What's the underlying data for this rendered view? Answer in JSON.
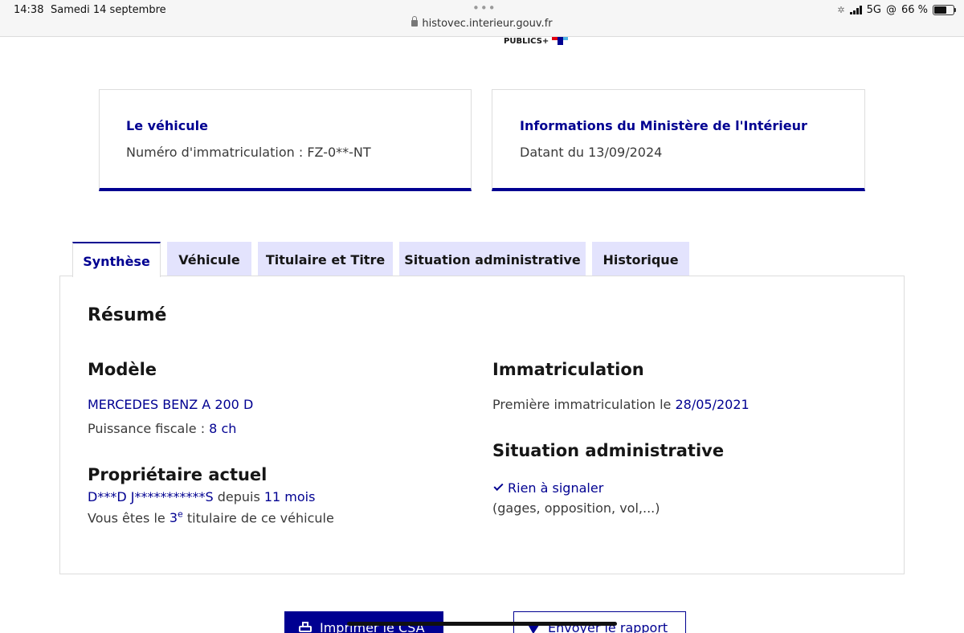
{
  "status_bar": {
    "time": "14:38",
    "date": "Samedi 14 septembre",
    "url": "histovec.interieur.gouv.fr",
    "network": "5G",
    "battery": "66 %",
    "battery_level": 0.66
  },
  "logo": {
    "text": "PUBLICS+"
  },
  "cards": {
    "vehicle": {
      "title": "Le véhicule",
      "text": "Numéro d'immatriculation : FZ-0**-NT"
    },
    "ministry": {
      "title": "Informations du Ministère de l'Intérieur",
      "text": "Datant du 13/09/2024"
    }
  },
  "tabs": [
    {
      "label": "Synthèse",
      "active": true
    },
    {
      "label": "Véhicule",
      "active": false
    },
    {
      "label": "Titulaire et Titre",
      "active": false
    },
    {
      "label": "Situation administrative",
      "active": false
    },
    {
      "label": "Historique",
      "active": false
    }
  ],
  "summary": {
    "heading": "Résumé",
    "model": {
      "heading": "Modèle",
      "name": "MERCEDES BENZ A 200 D",
      "power_label": "Puissance fiscale : ",
      "power_value": "8 ch"
    },
    "owner": {
      "heading": "Propriétaire actuel",
      "name": "D***D J***********S",
      "since_label": " depuis ",
      "since_value": "11 mois",
      "rank_prefix": "Vous êtes le ",
      "rank_number": "3",
      "rank_suffix": "e",
      "rank_rest": " titulaire de ce véhicule"
    },
    "registration": {
      "heading": "Immatriculation",
      "label": "Première immatriculation le ",
      "date": "28/05/2021"
    },
    "admin": {
      "heading": "Situation administrative",
      "status": "Rien à signaler",
      "details": "(gages, opposition, vol,...)"
    }
  },
  "actions": {
    "print_label": "Imprimer le CSA",
    "send_label": "Envoyer le rapport"
  }
}
